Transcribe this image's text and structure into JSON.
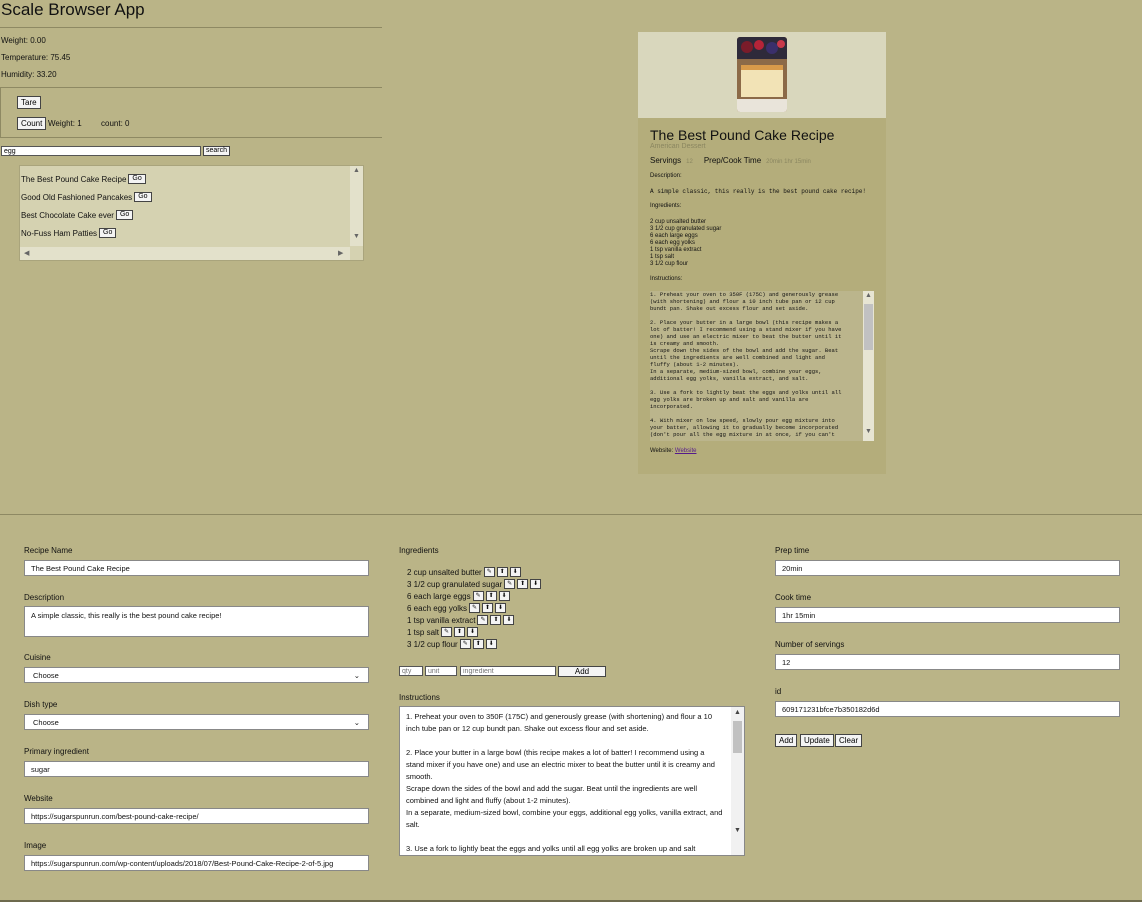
{
  "app": {
    "title": "Scale Browser App"
  },
  "readings": {
    "weight": "Weight: 0.00",
    "temperature": "Temperature: 75.45",
    "humidity": "Humidity: 33.20"
  },
  "controls": {
    "tare_label": "Tare",
    "count_label": "Count",
    "count_weight": "Weight: 1",
    "count_value": "count: 0"
  },
  "search": {
    "value": "egg",
    "button_label": "search"
  },
  "results": [
    {
      "title": "The Best Pound Cake Recipe",
      "go": "Go"
    },
    {
      "title": "Good Old Fashioned Pancakes",
      "go": "Go"
    },
    {
      "title": "Best Chocolate Cake ever",
      "go": "Go"
    },
    {
      "title": "No-Fuss Ham Patties",
      "go": "Go"
    }
  ],
  "card": {
    "title": "The Best Pound Cake Recipe",
    "cuisine": "American Dessert",
    "servings_label": "Servings",
    "servings_value": "12",
    "time_label": "Prep/Cook Time",
    "time_value": "20min 1hr 15min",
    "description_label": "Description:",
    "description": "A simple classic, this really is the best pound cake recipe!",
    "ingredients_label": "Ingredients:",
    "ingredients": [
      "2 cup unsalted butter",
      "3 1/2 cup granulated sugar",
      "6 each large eggs",
      "6 each egg yolks",
      "1 tsp vanilla extract",
      "1 tsp salt",
      "3 1/2 cup flour"
    ],
    "instructions_label": "Instructions:",
    "instructions": "1. Preheat your oven to 350F (175C) and generously grease\n(with shortening) and flour a 10 inch tube pan or 12 cup\nbundt pan. Shake out excess flour and set aside.\n\n2. Place your butter in a large bowl (this recipe makes a\nlot of batter! I recommend using a stand mixer if you have\none) and use an electric mixer to beat the butter until it\nis creamy and smooth.\nScrape down the sides of the bowl and add the sugar. Beat\nuntil the ingredients are well combined and light and\nfluffy (about 1-2 minutes).\nIn a separate, medium-sized bowl, combine your eggs,\nadditional egg yolks, vanilla extract, and salt.\n\n3. Use a fork to lightly beat the eggs and yolks until all\negg yolks are broken up and salt and vanilla are\nincorporated.\n\n4. With mixer on low speed, slowly pour egg mixture into\nyour batter, allowing it to gradually become incorporated\n(don't pour all the egg mixture in at once, if you can't",
    "website_label": "Website:",
    "website_link": "Website"
  },
  "form": {
    "recipe_name_label": "Recipe Name",
    "recipe_name_value": "The Best Pound Cake Recipe",
    "description_label": "Description",
    "description_value": "A simple classic, this really is the best pound cake recipe!",
    "cuisine_label": "Cuisine",
    "cuisine_value": "Choose",
    "dish_type_label": "Dish type",
    "dish_type_value": "Choose",
    "primary_ingredient_label": "Primary ingredient",
    "primary_ingredient_value": "sugar",
    "website_label": "Website",
    "website_value": "https://sugarspunrun.com/best-pound-cake-recipe/",
    "image_label": "Image",
    "image_value": "https://sugarspunrun.com/wp-content/uploads/2018/07/Best-Pound-Cake-Recipe-2-of-5.jpg",
    "ingredients_label": "Ingredients",
    "ingredients": [
      "2 cup unsalted butter",
      "3 1/2 cup granulated sugar",
      "6 each large eggs",
      "6 each egg yolks",
      "1 tsp vanilla extract",
      "1 tsp salt",
      "3 1/2 cup flour"
    ],
    "qty_placeholder": "qty",
    "unit_placeholder": "unit",
    "ingredient_placeholder": "ingredient",
    "add_ingredient_label": "Add",
    "instructions_label": "Instructions",
    "instructions_value": "1. Preheat your oven to 350F (175C) and generously grease (with shortening) and flour a 10 inch tube pan or 12 cup bundt pan. Shake out excess flour and set aside.\n\n2. Place your butter in a large bowl (this recipe makes a lot of batter! I recommend using a stand mixer if you have one) and use an electric mixer to beat the butter until it is creamy and smooth.\nScrape down the sides of the bowl and add the sugar. Beat until the ingredients are well combined and light and fluffy (about 1-2 minutes).\nIn a separate, medium-sized bowl, combine your eggs, additional egg yolks, vanilla extract, and salt.\n\n3. Use a fork to lightly beat the eggs and yolks until all egg yolks are broken up and salt",
    "prep_time_label": "Prep time",
    "prep_time_value": "20min",
    "cook_time_label": "Cook time",
    "cook_time_value": "1hr 15min",
    "servings_label": "Number of servings",
    "servings_value": "12",
    "id_label": "id",
    "id_value": "609171231bfce7b350182d6d",
    "add_label": "Add",
    "update_label": "Update",
    "clear_label": "Clear"
  },
  "colors": {
    "background": "#bab487",
    "card_top": "#d9d7bd",
    "link": "#551a8b"
  }
}
